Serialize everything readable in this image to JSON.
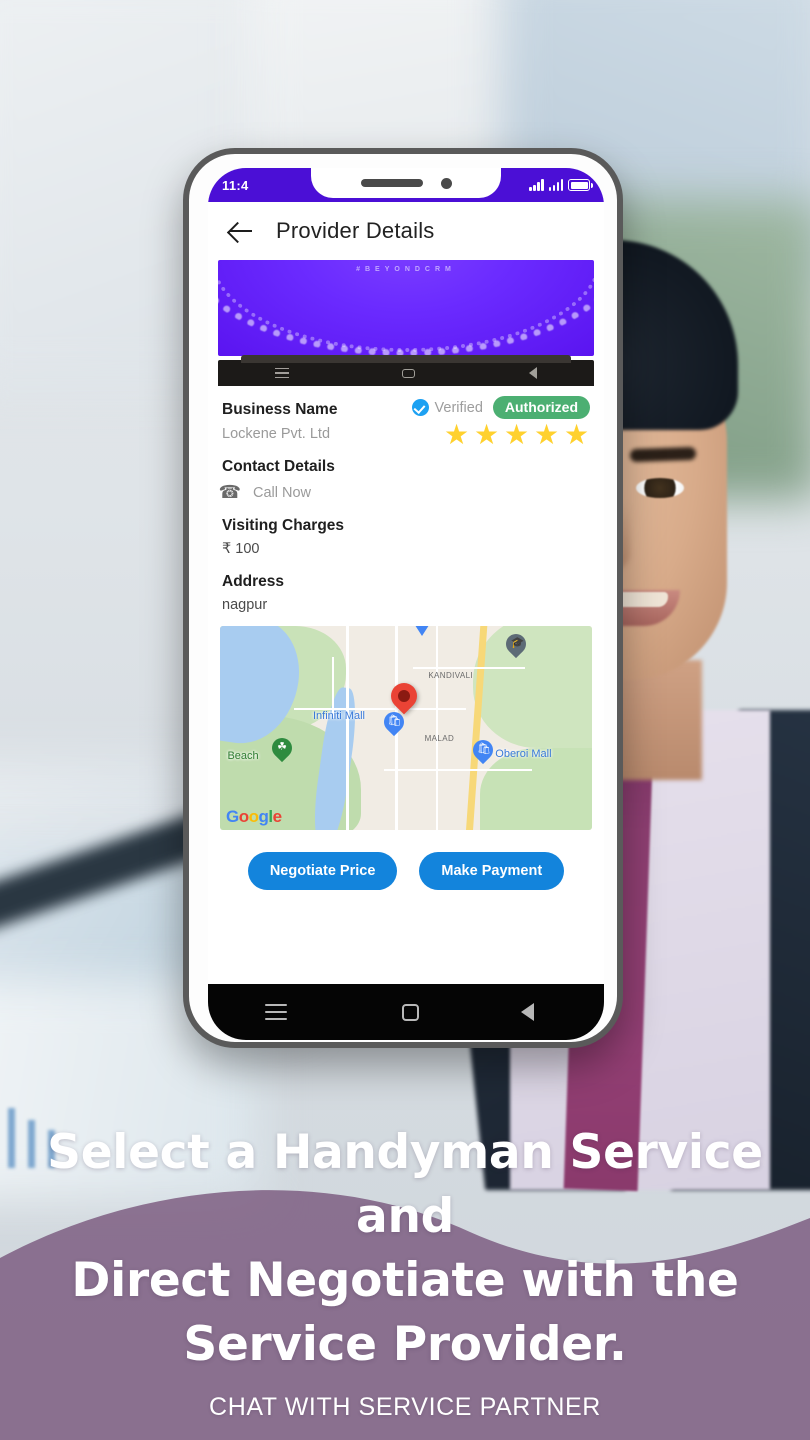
{
  "phone": {
    "status_bar": {
      "time": "11:4",
      "signal_icon": "signal-bars-icon",
      "battery_icon": "battery-icon"
    },
    "app_bar": {
      "back_icon": "back-arrow-icon",
      "title": "Provider Details"
    },
    "banner": {
      "tag_text": "#BEYONDCRM"
    },
    "details": {
      "business_name_label": "Business Name",
      "verified_text": "Verified",
      "verified_icon": "verified-check-icon",
      "authorized_badge": "Authorized",
      "business_name_value": "Lockene Pvt. Ltd",
      "rating_stars": 5,
      "star_glyph": "★",
      "contact_label": "Contact Details",
      "call_icon": "phone-icon",
      "call_action": "Call Now",
      "visiting_charges_label": "Visiting Charges",
      "visiting_charges_value": "₹ 100",
      "address_label": "Address",
      "address_value": "nagpur"
    },
    "map": {
      "labels": [
        {
          "text": "KANDIVALI",
          "type": "area"
        },
        {
          "text": "MALAD",
          "type": "area"
        }
      ],
      "pois": [
        {
          "text": "Infiniti Mall",
          "type": "poi"
        },
        {
          "text": "Oberoi Mall",
          "type": "poi"
        },
        {
          "text": "Beach",
          "type": "park"
        }
      ],
      "attribution": "Google",
      "marker_icon": "map-pin-icon"
    },
    "actions": {
      "negotiate_label": "Negotiate Price",
      "payment_label": "Make Payment"
    },
    "nav_bar": {
      "menu_icon": "menu-icon",
      "home_icon": "home-square-icon",
      "back_icon": "back-triangle-icon"
    }
  },
  "caption": {
    "line1": "Select a Handyman Service and",
    "line2": "Direct Negotiate with the",
    "line3": "Service Provider.",
    "subtitle": "CHAT WITH SERVICE PARTNER"
  },
  "colors": {
    "status_bar_purple": "#4B0FD6",
    "banner_purple": "#6B2BFF",
    "verified_blue": "#1DA1F2",
    "authorized_green": "#4CAF72",
    "star_yellow": "#FFD12E",
    "button_blue": "#1384DC",
    "map_pin_red": "#EA4335",
    "overlay_purple": "#8E6F90"
  }
}
